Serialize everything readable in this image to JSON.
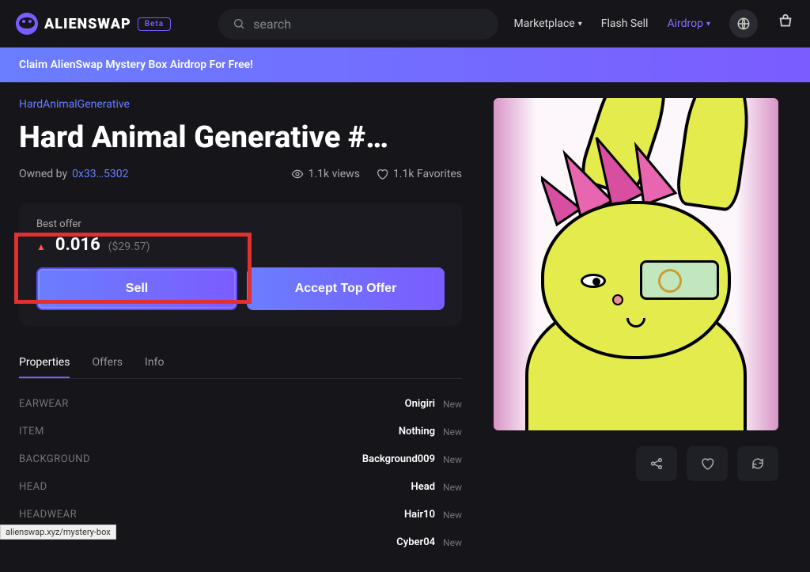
{
  "header": {
    "brand": "ALIENSWAP",
    "badge": "Beta",
    "search_placeholder": "search",
    "nav": {
      "marketplace": "Marketplace",
      "flash_sell": "Flash Sell",
      "airdrop": "Airdrop"
    }
  },
  "banner": {
    "text": "Claim AlienSwap Mystery Box Airdrop For Free!"
  },
  "nft": {
    "collection": "HardAnimalGenerative",
    "title": "Hard Animal Generative #…",
    "owned_by_label": "Owned by",
    "owner": "0x33…5302",
    "views": "1.1k views",
    "favorites": "1.1k Favorites"
  },
  "offer": {
    "label": "Best offer",
    "price": "0.016",
    "usd": "($29.57)",
    "sell_label": "Sell",
    "accept_label": "Accept Top Offer"
  },
  "tabs": {
    "properties": "Properties",
    "offers": "Offers",
    "info": "Info"
  },
  "properties": [
    {
      "key": "EARWEAR",
      "value": "Onigiri",
      "tag": "New"
    },
    {
      "key": "ITEM",
      "value": "Nothing",
      "tag": "New"
    },
    {
      "key": "BACKGROUND",
      "value": "Background009",
      "tag": "New"
    },
    {
      "key": "HEAD",
      "value": "Head",
      "tag": "New"
    },
    {
      "key": "HEADWEAR",
      "value": "Hair10",
      "tag": "New"
    },
    {
      "key": "",
      "value": "Cyber04",
      "tag": "New"
    }
  ],
  "tooltip": {
    "url": "alienswap.xyz/mystery-box"
  }
}
